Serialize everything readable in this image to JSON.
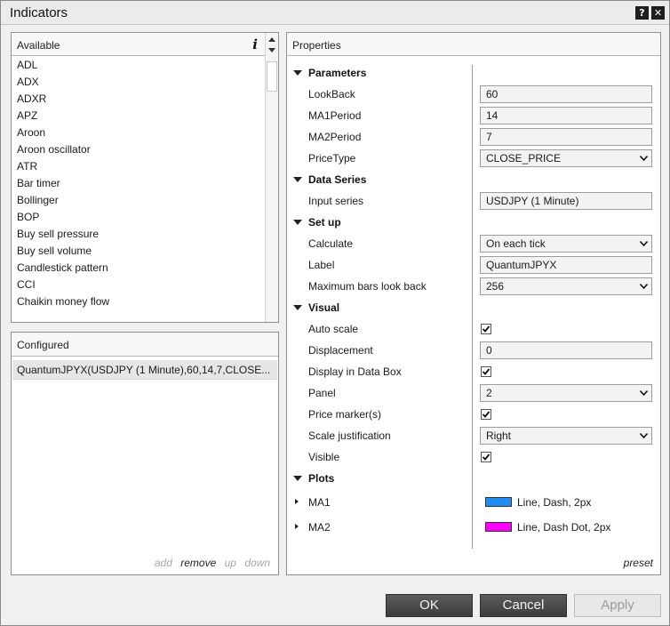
{
  "window": {
    "title": "Indicators",
    "help_icon": "question-icon",
    "close_icon": "close-icon"
  },
  "available": {
    "header": "Available",
    "info_icon": "i",
    "items": [
      "ADL",
      "ADX",
      "ADXR",
      "APZ",
      "Aroon",
      "Aroon oscillator",
      "ATR",
      "Bar timer",
      "Bollinger",
      "BOP",
      "Buy sell pressure",
      "Buy sell volume",
      "Candlestick pattern",
      "CCI",
      "Chaikin money flow"
    ]
  },
  "configured": {
    "header": "Configured",
    "items": [
      "QuantumJPYX(USDJPY (1 Minute),60,14,7,CLOSE..."
    ],
    "actions": {
      "add": "add",
      "remove": "remove",
      "up": "up",
      "down": "down"
    }
  },
  "properties": {
    "header": "Properties",
    "parameters": {
      "title": "Parameters",
      "lookback": {
        "label": "LookBack",
        "value": "60"
      },
      "ma1period": {
        "label": "MA1Period",
        "value": "14"
      },
      "ma2period": {
        "label": "MA2Period",
        "value": "7"
      },
      "pricetype": {
        "label": "PriceType",
        "value": "CLOSE_PRICE"
      }
    },
    "data_series": {
      "title": "Data Series",
      "input_series": {
        "label": "Input series",
        "value": "USDJPY (1 Minute)"
      }
    },
    "set_up": {
      "title": "Set up",
      "calculate": {
        "label": "Calculate",
        "value": "On each tick"
      },
      "label": {
        "label": "Label",
        "value": "QuantumJPYX"
      },
      "max_bars": {
        "label": "Maximum bars look back",
        "value": "256"
      }
    },
    "visual": {
      "title": "Visual",
      "auto_scale": {
        "label": "Auto scale",
        "checked": true
      },
      "displacement": {
        "label": "Displacement",
        "value": "0"
      },
      "display_in_data_box": {
        "label": "Display in Data Box",
        "checked": true
      },
      "panel": {
        "label": "Panel",
        "value": "2"
      },
      "price_markers": {
        "label": "Price marker(s)",
        "checked": true
      },
      "scale_justification": {
        "label": "Scale justification",
        "value": "Right"
      },
      "visible": {
        "label": "Visible",
        "checked": true
      }
    },
    "plots": {
      "title": "Plots",
      "ma1": {
        "label": "MA1",
        "desc": "Line, Dash, 2px",
        "color": "#1e8cf0"
      },
      "ma2": {
        "label": "MA2",
        "desc": "Line, Dash Dot, 2px",
        "color": "#ff00ff"
      }
    },
    "preset": "preset"
  },
  "buttons": {
    "ok": "OK",
    "cancel": "Cancel",
    "apply": "Apply"
  }
}
